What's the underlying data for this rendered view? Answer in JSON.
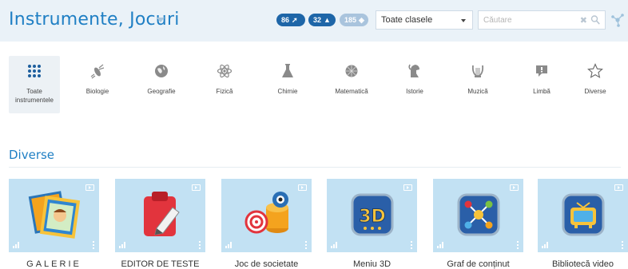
{
  "header": {
    "title": "Instrumente, Jocuri",
    "badges": {
      "tools": "86",
      "users": "32",
      "items": "185"
    },
    "class_select": "Toate clasele",
    "search_placeholder": "Căutare"
  },
  "categories": [
    {
      "label_line1": "Toate",
      "label_line2": "instrumentele",
      "icon": "grid-icon",
      "active": true
    },
    {
      "label_line1": "Biologie",
      "label_line2": "",
      "icon": "insect-icon"
    },
    {
      "label_line1": "Geografie",
      "label_line2": "",
      "icon": "globe-icon"
    },
    {
      "label_line1": "Fizică",
      "label_line2": "",
      "icon": "atom-icon"
    },
    {
      "label_line1": "Chimie",
      "label_line2": "",
      "icon": "flask-icon"
    },
    {
      "label_line1": "Matematică",
      "label_line2": "",
      "icon": "geometry-icon"
    },
    {
      "label_line1": "Istorie",
      "label_line2": "",
      "icon": "helmet-icon"
    },
    {
      "label_line1": "Muzică",
      "label_line2": "",
      "icon": "lyre-icon"
    },
    {
      "label_line1": "Limbă",
      "label_line2": "",
      "icon": "speech-bubble-icon"
    },
    {
      "label_line1": "Diverse",
      "label_line2": "",
      "icon": "star-icon"
    }
  ],
  "section": {
    "title": "Diverse"
  },
  "cards": [
    {
      "label": "GALERIE",
      "icon": "picture-frames-icon"
    },
    {
      "label": "EDITOR DE TESTE",
      "icon": "clipboard-pencil-icon"
    },
    {
      "label": "Joc de societate",
      "icon": "board-game-icon"
    },
    {
      "label": "Meniu 3D",
      "icon": "3d-menu-icon"
    },
    {
      "label": "Graf de conținut",
      "icon": "content-graph-icon"
    },
    {
      "label": "Bibliotecă video",
      "icon": "video-library-icon"
    }
  ],
  "colors": {
    "accent": "#1f7fc4",
    "header_bg": "#eaf2f8",
    "badge_dark": "#1e66a8",
    "badge_light": "#a9c4dd",
    "card_bg": "#c2e1f3"
  }
}
